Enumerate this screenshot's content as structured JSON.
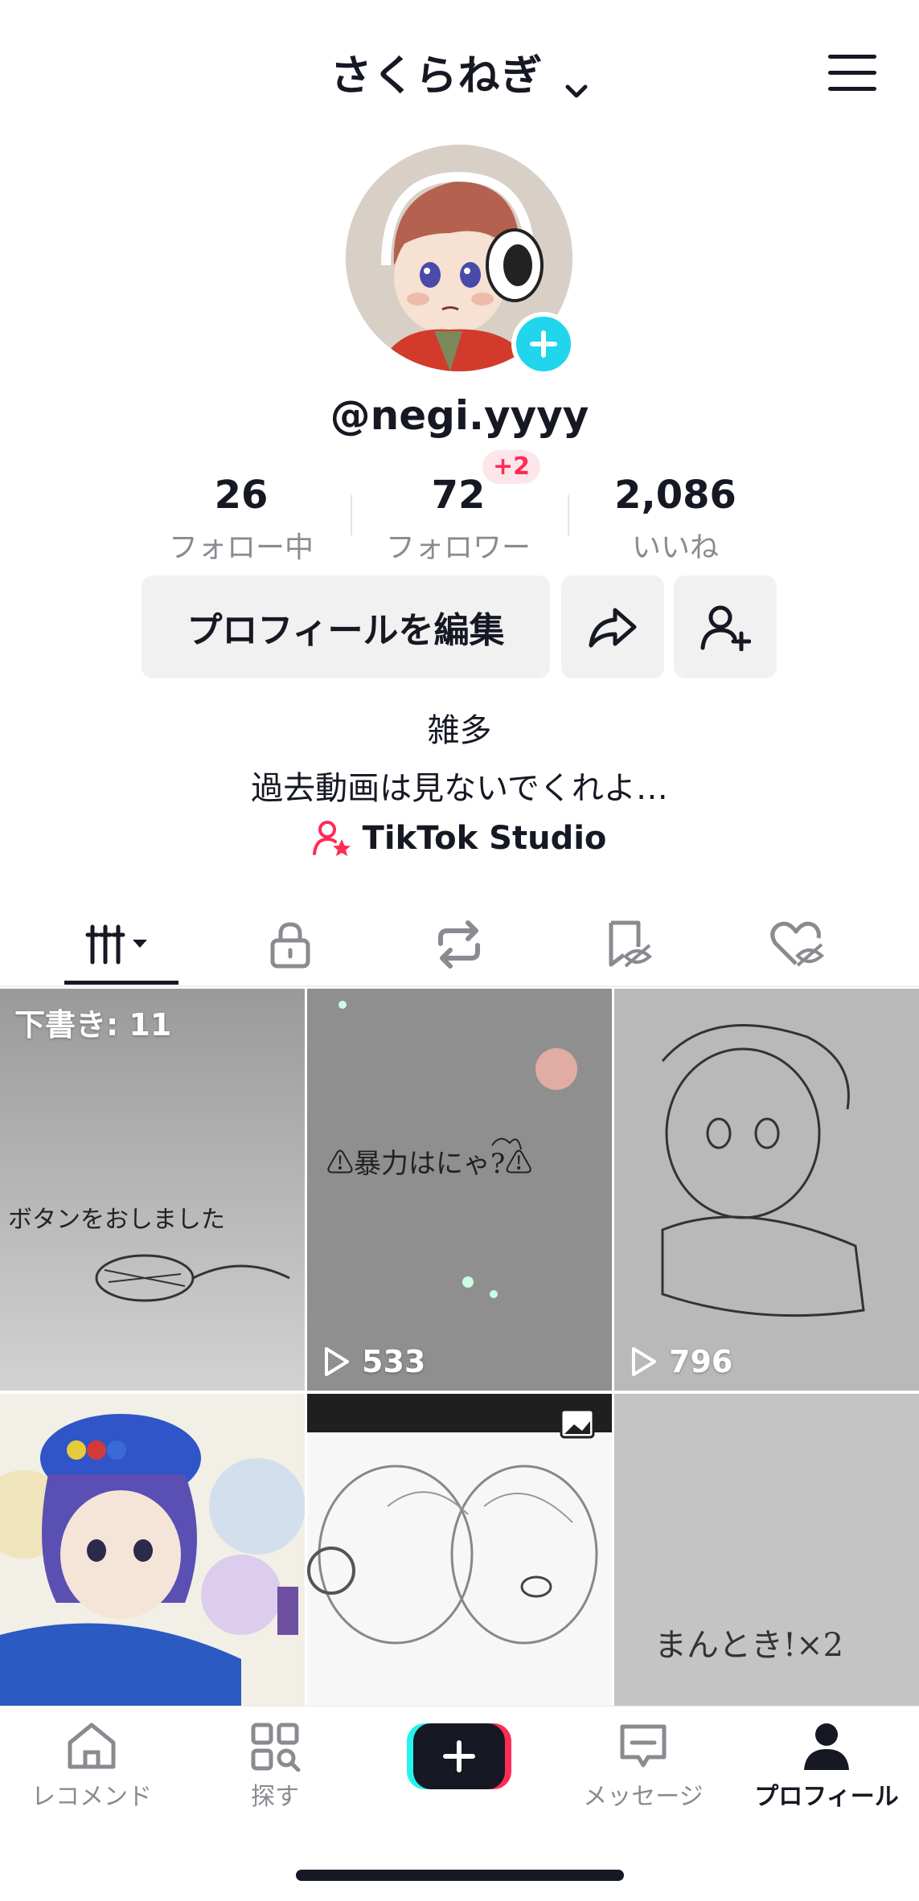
{
  "header": {
    "title": "さくらねぎ",
    "title_icon": "chevron-down-icon",
    "menu_icon": "hamburger-menu-icon"
  },
  "profile": {
    "username": "@negi.yyyy"
  },
  "stats": {
    "following": {
      "value": "26",
      "label": "フォロー中"
    },
    "followers": {
      "value": "72",
      "label": "フォロワー",
      "badge": "+2"
    },
    "likes": {
      "value": "2,086",
      "label": "いいね"
    }
  },
  "buttons": {
    "edit_profile": "プロフィールを編集",
    "share_icon": "share-icon",
    "add_friend_icon": "add-friend-icon"
  },
  "bio": {
    "line1": "雑多",
    "line2": "過去動画は見ないでくれよ…",
    "studio_link": "TikTok Studio"
  },
  "tabs": [
    "videos-tab",
    "private-tab",
    "reposts-tab",
    "favorites-tab",
    "liked-tab"
  ],
  "grid": {
    "items": [
      {
        "label": "下書き: 11",
        "caption": "ボタンをおしました"
      },
      {
        "views": "533",
        "caption": "⚠暴力はにゃ?⚠"
      },
      {
        "views": "796"
      },
      {},
      {},
      {
        "caption": "まんとき!×2"
      }
    ]
  },
  "nav": {
    "items": [
      {
        "label": "レコメンド",
        "icon": "home-icon"
      },
      {
        "label": "探す",
        "icon": "explore-icon"
      },
      {
        "label": "",
        "icon": "create-plus-icon"
      },
      {
        "label": "メッセージ",
        "icon": "message-icon"
      },
      {
        "label": "プロフィール",
        "icon": "profile-icon",
        "active": true
      }
    ]
  },
  "colors": {
    "accent_cyan": "#20d5ec",
    "accent_red": "#fe2c55",
    "text": "#161823",
    "muted": "#8a8b91"
  }
}
